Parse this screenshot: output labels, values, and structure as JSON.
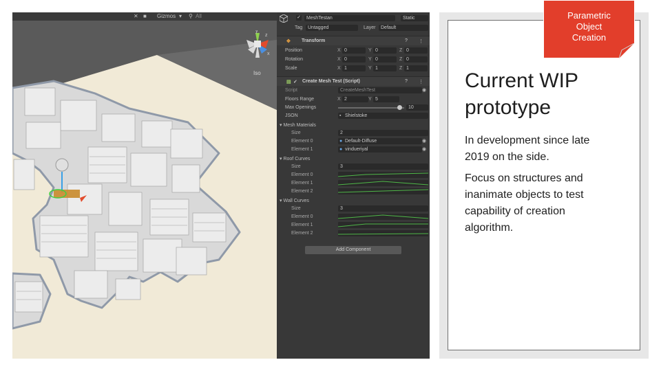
{
  "scene": {
    "toolbar_gizmos": "Gizmos",
    "toolbar_search": "All",
    "view_mode": "Iso",
    "gizmo_axes": [
      "y",
      "z",
      "x"
    ]
  },
  "inspector": {
    "object_name": "MeshTestan",
    "static_label": "Static",
    "tag_label": "Tag",
    "tag_value": "Untagged",
    "layer_label": "Layer",
    "layer_value": "Default",
    "transform": {
      "title": "Transform",
      "rows": [
        {
          "label": "Position",
          "x": "0",
          "y": "0",
          "z": "0"
        },
        {
          "label": "Rotation",
          "x": "0",
          "y": "0",
          "z": "0"
        },
        {
          "label": "Scale",
          "x": "1",
          "y": "1",
          "z": "1"
        }
      ]
    },
    "script": {
      "title": "Create Mesh Test (Script)",
      "script_label": "Script",
      "script_value": "CreateMeshTest",
      "floors_label": "Floors Range",
      "floors_x": "2",
      "floors_y": "5",
      "openings_label": "Max Openings",
      "openings_value": "10",
      "openings_fraction": 0.93,
      "json_label": "JSON",
      "json_value": "Shielstoke",
      "mesh_materials_label": "Mesh Materials",
      "size_label": "Size",
      "mesh_materials_size": "2",
      "element0_label": "Element 0",
      "element1_label": "Element 1",
      "element2_label": "Element 2",
      "element0_value": "Default-Diffuse",
      "element1_value": "vindueriyal",
      "roof_curves_label": "Roof Curves",
      "roof_curves_size": "3",
      "wall_curves_label": "Wall Curves",
      "wall_curves_size": "3"
    },
    "add_component": "Add Component"
  },
  "slide": {
    "badge": "Parametric\nObject\nCreation",
    "title": "Current WIP\nprototype",
    "paragraph1": "In development since late\n2019 on the side.",
    "paragraph2": "Focus on structures and\ninanimate objects to test\ncapability of creation\nalgorithm."
  },
  "colors": {
    "badge": "#e23e2b",
    "inspector_bg": "#383838",
    "ground": "#f1ead7",
    "curve_line": "#4fb848"
  }
}
